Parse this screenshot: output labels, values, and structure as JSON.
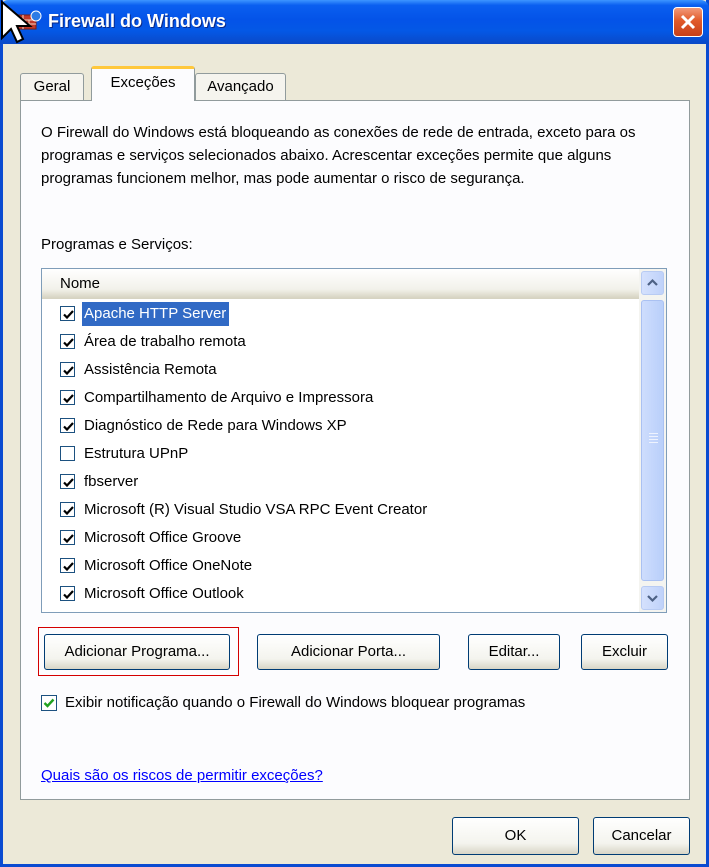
{
  "window": {
    "title": "Firewall do Windows"
  },
  "tabs": [
    {
      "label": "Geral"
    },
    {
      "label": "Exceções"
    },
    {
      "label": "Avançado"
    }
  ],
  "description": "O Firewall do Windows está bloqueando as conexões de rede de entrada, exceto para os programas e serviços selecionados abaixo. Acrescentar exceções permite que alguns programas funcionem melhor, mas pode aumentar o risco de segurança.",
  "list": {
    "section_label": "Programas e Serviços:",
    "column_header": "Nome",
    "items": [
      {
        "label": "Apache HTTP Server",
        "checked": true,
        "selected": true
      },
      {
        "label": "Área de trabalho remota",
        "checked": true
      },
      {
        "label": "Assistência Remota",
        "checked": true
      },
      {
        "label": "Compartilhamento de Arquivo e Impressora",
        "checked": true
      },
      {
        "label": "Diagnóstico de Rede para Windows XP",
        "checked": true
      },
      {
        "label": "Estrutura UPnP",
        "checked": false
      },
      {
        "label": "fbserver",
        "checked": true
      },
      {
        "label": "Microsoft (R) Visual Studio VSA RPC Event Creator",
        "checked": true
      },
      {
        "label": "Microsoft Office Groove",
        "checked": true
      },
      {
        "label": "Microsoft Office OneNote",
        "checked": true
      },
      {
        "label": "Microsoft Office Outlook",
        "checked": true
      }
    ]
  },
  "buttons": {
    "add_program": "Adicionar Programa...",
    "add_port": "Adicionar Porta...",
    "edit": "Editar...",
    "delete": "Excluir",
    "ok": "OK",
    "cancel": "Cancelar"
  },
  "notification": {
    "label": "Exibir notificação quando o Firewall do Windows bloquear programas",
    "checked": true
  },
  "help_link": "Quais são os riscos de permitir exceções?",
  "colors": {
    "titlebar": "#0453E8",
    "selection": "#316AC5",
    "checkmark_green": "#21A121",
    "link": "#0000FF",
    "focus_ring": "#D40000"
  }
}
